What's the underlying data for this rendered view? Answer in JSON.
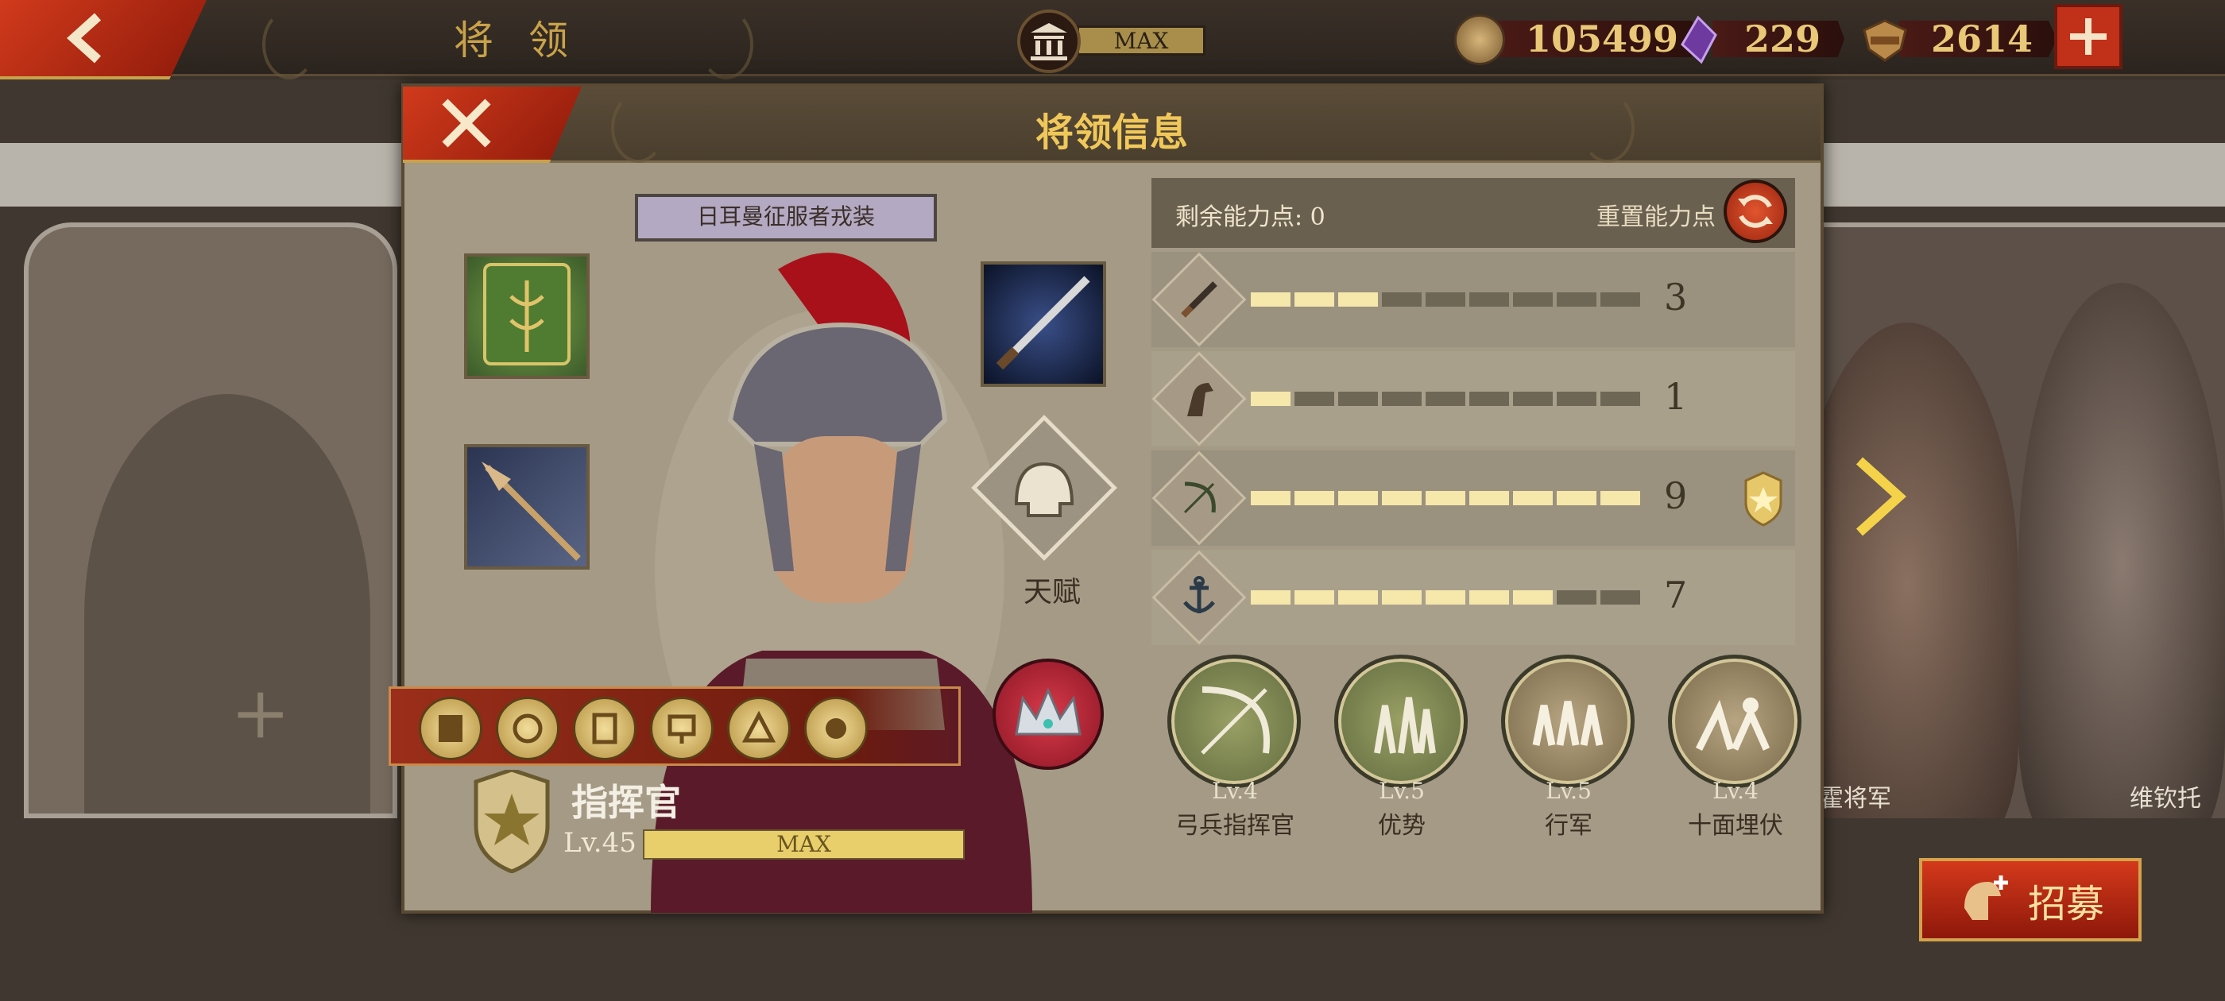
{
  "topbar": {
    "page_title": "将 领",
    "building_level": "MAX",
    "resources": [
      {
        "name": "coin",
        "value": "105499",
        "icon": "coin-icon"
      },
      {
        "name": "gem",
        "value": "229",
        "icon": "purple-gem-icon"
      },
      {
        "name": "spqr",
        "value": "2614",
        "icon": "spqr-eagle-icon"
      }
    ]
  },
  "dialog": {
    "title": "将领信息",
    "outfit_label": "日耳曼征服者戎装",
    "talent_label": "天赋",
    "hero": {
      "rank": "指挥官",
      "level": "Lv.45",
      "level_bar": "MAX"
    },
    "points": {
      "label": "剩余能力点: 0",
      "reset_label": "重置能力点"
    },
    "stats": [
      {
        "icon": "sword-icon",
        "value": 3,
        "max": 9,
        "display": "3"
      },
      {
        "icon": "horse-head-icon",
        "value": 1,
        "max": 9,
        "display": "1"
      },
      {
        "icon": "bow-icon",
        "value": 9,
        "max": 9,
        "display": "9"
      },
      {
        "icon": "anchor-icon",
        "value": 7,
        "max": 9,
        "display": "7"
      }
    ],
    "skills": [
      {
        "level": "Lv.4",
        "name": "弓兵指挥官"
      },
      {
        "level": "Lv.5",
        "name": "优势"
      },
      {
        "level": "Lv.5",
        "name": "行军"
      },
      {
        "level": "Lv.4",
        "name": "十面埋伏"
      }
    ]
  },
  "side": {
    "right_names": [
      "霍将军",
      "维钦托"
    ],
    "recruit_label": "招募"
  },
  "colors": {
    "accent_red": "#c13018",
    "gold": "#f0c85a",
    "bar_fill": "#f6e7aa"
  }
}
